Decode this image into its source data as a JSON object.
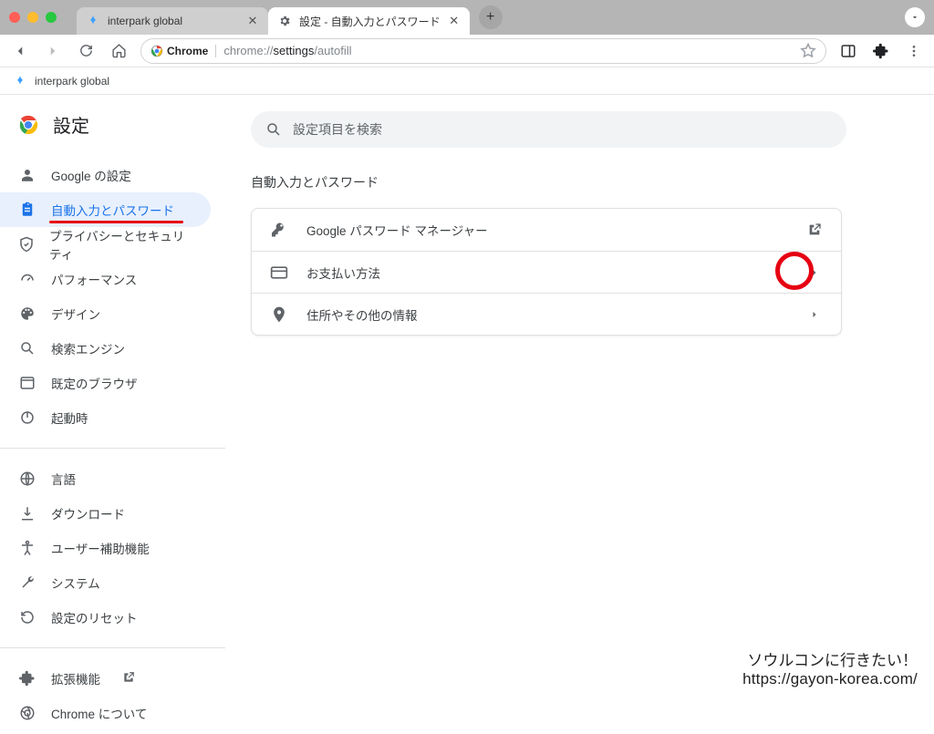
{
  "browser_tabs": {
    "tab0_label": "interpark global",
    "tab1_label": "設定 - 自動入力とパスワード"
  },
  "addr": {
    "chip": "Chrome",
    "url_prefix": "chrome://",
    "url_mid": "settings",
    "url_tail": "/autofill"
  },
  "bookmarks": {
    "item0": "interpark global"
  },
  "sidebar": {
    "title": "設定",
    "items": [
      {
        "label": "Google の設定"
      },
      {
        "label": "自動入力とパスワード"
      },
      {
        "label": "プライバシーとセキュリティ"
      },
      {
        "label": "パフォーマンス"
      },
      {
        "label": "デザイン"
      },
      {
        "label": "検索エンジン"
      },
      {
        "label": "既定のブラウザ"
      },
      {
        "label": "起動時"
      }
    ],
    "group2": [
      {
        "label": "言語"
      },
      {
        "label": "ダウンロード"
      },
      {
        "label": "ユーザー補助機能"
      },
      {
        "label": "システム"
      },
      {
        "label": "設定のリセット"
      }
    ],
    "group3": [
      {
        "label": "拡張機能"
      },
      {
        "label": "Chrome について"
      }
    ]
  },
  "main": {
    "search_placeholder": "設定項目を検索",
    "section_title": "自動入力とパスワード",
    "rows": [
      {
        "label": "Google パスワード マネージャー"
      },
      {
        "label": "お支払い方法"
      },
      {
        "label": "住所やその他の情報"
      }
    ]
  },
  "watermark": {
    "line1": "ソウルコンに行きたい！",
    "line2": "https://gayon-korea.com/"
  }
}
